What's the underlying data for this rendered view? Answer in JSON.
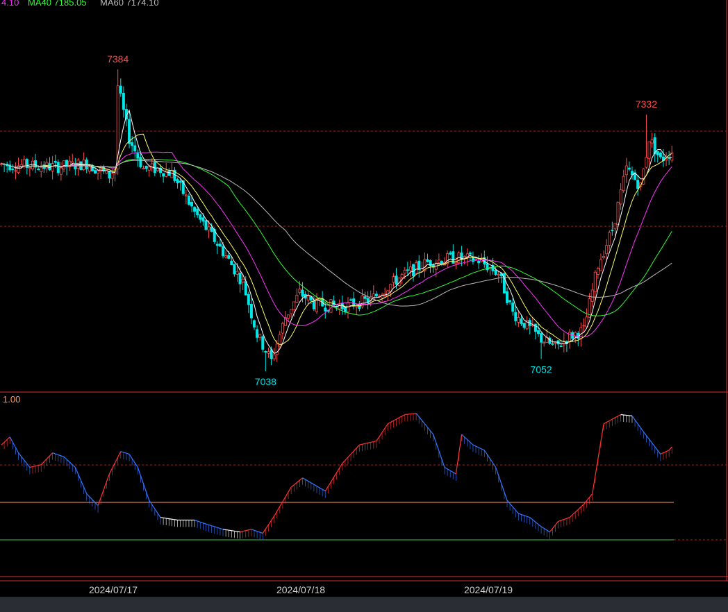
{
  "legend": {
    "ma20_text": "4.10",
    "ma40_text": "MA40  7185.05",
    "ma60_text": "MA60  7174.10"
  },
  "colors": {
    "up": "#ff4d4d",
    "down": "#00e5e5",
    "ma5": "#ffffff",
    "ma10": "#ffff66",
    "ma20": "#ff33ff",
    "ma40": "#33ff33",
    "ma60": "#bbbbbb",
    "frame": "#e03030",
    "grid": "#a02020"
  },
  "chart_data": [
    {
      "type": "candlestick",
      "x_labels": [
        "2024/07/17",
        "2024/07/18",
        "2024/07/19"
      ],
      "ylim": [
        7030,
        7395
      ],
      "annotations": [
        {
          "label": "7384",
          "value": 7384,
          "kind": "high"
        },
        {
          "label": "7038",
          "value": 7038,
          "kind": "low"
        },
        {
          "label": "7052",
          "value": 7052,
          "kind": "low"
        },
        {
          "label": "7332",
          "value": 7332,
          "kind": "high"
        }
      ],
      "price_anchors": [
        [
          0,
          7275
        ],
        [
          20,
          7272
        ],
        [
          30,
          7276
        ],
        [
          38,
          7262
        ],
        [
          40,
          7270
        ],
        [
          41,
          7365
        ],
        [
          45,
          7305
        ],
        [
          50,
          7270
        ],
        [
          55,
          7270
        ],
        [
          60,
          7265
        ],
        [
          68,
          7220
        ],
        [
          78,
          7175
        ],
        [
          85,
          7140
        ],
        [
          90,
          7080
        ],
        [
          95,
          7050
        ],
        [
          100,
          7100
        ],
        [
          105,
          7128
        ],
        [
          110,
          7115
        ],
        [
          120,
          7112
        ],
        [
          130,
          7120
        ],
        [
          140,
          7145
        ],
        [
          150,
          7163
        ],
        [
          160,
          7168
        ],
        [
          168,
          7165
        ],
        [
          175,
          7150
        ],
        [
          180,
          7105
        ],
        [
          185,
          7090
        ],
        [
          190,
          7075
        ],
        [
          195,
          7065
        ],
        [
          200,
          7078
        ],
        [
          205,
          7085
        ],
        [
          210,
          7160
        ],
        [
          215,
          7200
        ],
        [
          220,
          7270
        ],
        [
          225,
          7250
        ],
        [
          228,
          7305
        ],
        [
          232,
          7280
        ],
        [
          236,
          7290
        ]
      ],
      "series": [
        {
          "name": "MA40",
          "color": "#33ff33"
        },
        {
          "name": "MA60",
          "color": "#bbbbbb"
        }
      ]
    },
    {
      "type": "line",
      "label": "1.00",
      "ylim": [
        0,
        1
      ],
      "reference_lines": [
        0.8,
        0.5,
        0.2,
        0.0
      ],
      "anchors": [
        [
          0,
          0.72
        ],
        [
          3,
          0.78
        ],
        [
          6,
          0.66
        ],
        [
          10,
          0.55
        ],
        [
          14,
          0.57
        ],
        [
          18,
          0.66
        ],
        [
          22,
          0.63
        ],
        [
          26,
          0.55
        ],
        [
          30,
          0.35
        ],
        [
          34,
          0.26
        ],
        [
          38,
          0.5
        ],
        [
          42,
          0.67
        ],
        [
          45,
          0.65
        ],
        [
          48,
          0.55
        ],
        [
          52,
          0.3
        ],
        [
          56,
          0.17
        ],
        [
          62,
          0.15
        ],
        [
          68,
          0.15
        ],
        [
          72,
          0.12
        ],
        [
          78,
          0.08
        ],
        [
          84,
          0.06
        ],
        [
          88,
          0.08
        ],
        [
          92,
          0.05
        ],
        [
          96,
          0.18
        ],
        [
          102,
          0.4
        ],
        [
          106,
          0.47
        ],
        [
          110,
          0.42
        ],
        [
          114,
          0.37
        ],
        [
          120,
          0.58
        ],
        [
          126,
          0.72
        ],
        [
          132,
          0.75
        ],
        [
          136,
          0.88
        ],
        [
          142,
          0.95
        ],
        [
          146,
          0.96
        ],
        [
          152,
          0.8
        ],
        [
          156,
          0.55
        ],
        [
          160,
          0.5
        ],
        [
          162,
          0.8
        ],
        [
          166,
          0.72
        ],
        [
          170,
          0.68
        ],
        [
          174,
          0.55
        ],
        [
          178,
          0.3
        ],
        [
          182,
          0.2
        ],
        [
          186,
          0.17
        ],
        [
          190,
          0.1
        ],
        [
          193,
          0.06
        ],
        [
          196,
          0.14
        ],
        [
          200,
          0.17
        ],
        [
          205,
          0.27
        ],
        [
          208,
          0.35
        ],
        [
          212,
          0.88
        ],
        [
          218,
          0.95
        ],
        [
          222,
          0.94
        ],
        [
          226,
          0.82
        ],
        [
          232,
          0.65
        ],
        [
          235,
          0.68
        ],
        [
          237,
          0.73
        ]
      ]
    }
  ]
}
